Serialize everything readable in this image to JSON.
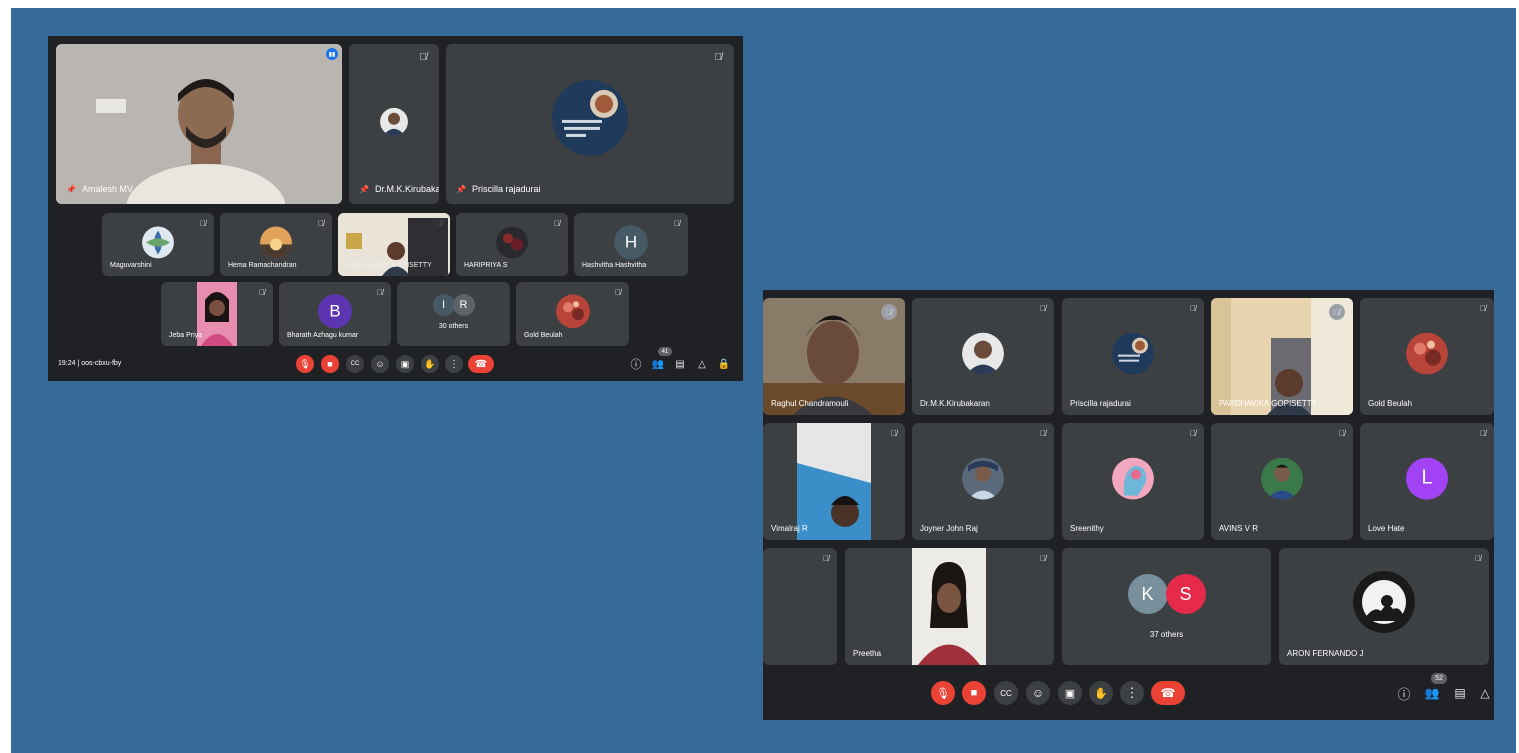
{
  "screen1": {
    "tiles": {
      "amalesh": "Amalesh MV",
      "kirubakaran": "Dr.M.K.Kirubakaran",
      "priscilla": "Priscilla rajadurai",
      "maguvarshini": "Maguvarshini",
      "hema": "Hema Ramachandran",
      "pardhavika": "PARDHAVIKA GOPISETTY",
      "haripriya": "HARIPRIYA S",
      "hashvitha": "Hashvitha Hashvitha",
      "jeba": "Jeba Priya",
      "bharath": "Bharath Azhagu kumar",
      "others": "30 others",
      "gold": "Gold Beulah"
    },
    "initials": {
      "hashvitha": "H",
      "bharath": "B",
      "others_1": "I",
      "others_2": "R"
    },
    "meeting_info": "19:24  |  oos-cbxu-fby",
    "people_count": "41"
  },
  "screen2": {
    "tiles": {
      "raghul": "Raghul Chandramouli",
      "kirubakaran": "Dr.M.K.Kirubakaran",
      "priscilla": "Priscilla rajadurai",
      "pardhavika": "PARDHAVIKA GOPISETTY",
      "gold": "Gold Beulah",
      "vimalraj": "Vimalraj R",
      "joyner": "Joyner John Raj",
      "sreenithy": "Sreenithy",
      "avins": "AVINS V R",
      "love": "Love Hate",
      "preetha": "Preetha",
      "others": "37 others",
      "aron": "ARON FERNANDO J"
    },
    "initials": {
      "love": "L",
      "others_1": "K",
      "others_2": "S"
    },
    "people_count": "52"
  },
  "icons": {
    "mic_off": "mic-off-icon",
    "cam_off": "camera-off-icon",
    "captions": "captions-icon",
    "emoji": "emoji-icon",
    "present": "present-icon",
    "hand": "raise-hand-icon",
    "more": "more-options-icon",
    "end": "end-call-icon",
    "info": "info-icon",
    "people": "people-icon",
    "chat": "chat-icon",
    "activities": "activities-icon",
    "lock": "host-controls-icon",
    "pin": "pin-icon",
    "muted": "muted-icon"
  },
  "colors": {
    "background": "#356a99",
    "meet_bg": "#202124",
    "tile": "#3c4043",
    "red": "#ea4335",
    "purple": "#a142f4",
    "indigo": "#5e35b1",
    "grey_avatar": "#5f6368"
  }
}
